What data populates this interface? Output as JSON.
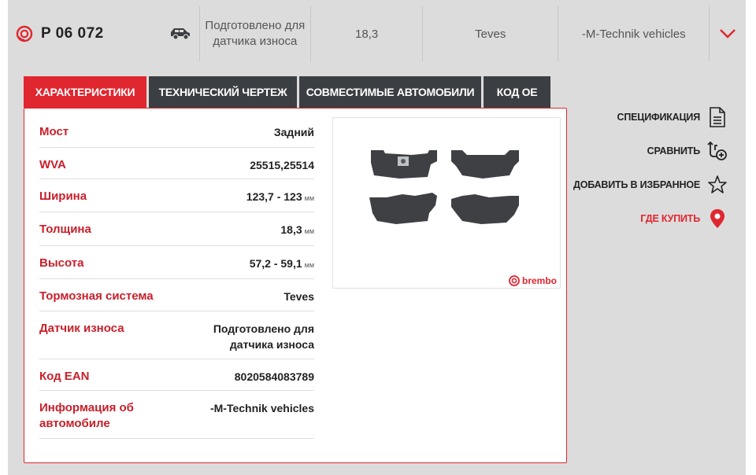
{
  "summary": {
    "part_number": "P 06 072",
    "wear_sensor": "Подготовлено для датчика износа",
    "thickness": "18,3",
    "brake_system": "Teves",
    "vehicle_info": "-M-Technik vehicles"
  },
  "tabs": [
    {
      "label": "ХАРАКТЕРИСТИКИ",
      "active": true
    },
    {
      "label": "ТЕХНИЧЕСКИЙ ЧЕРТЕЖ",
      "active": false
    },
    {
      "label": "СОВМЕСТИМЫЕ АВТОМОБИЛИ",
      "active": false
    },
    {
      "label": "КОД ОЕ",
      "active": false
    }
  ],
  "specs": [
    {
      "label": "Мост",
      "value": "Задний",
      "unit": ""
    },
    {
      "label": "WVA",
      "value": "25515,25514",
      "unit": ""
    },
    {
      "label": "Ширина",
      "value": "123,7 - 123",
      "unit": "мм"
    },
    {
      "label": "Толщина",
      "value": "18,3",
      "unit": "мм"
    },
    {
      "label": "Высота",
      "value": "57,2 - 59,1",
      "unit": "мм"
    },
    {
      "label": "Тормозная система",
      "value": "Teves",
      "unit": ""
    },
    {
      "label": "Датчик износа",
      "value": "Подготовлено для датчика износа",
      "unit": ""
    },
    {
      "label": "Код EAN",
      "value": "8020584083789",
      "unit": ""
    },
    {
      "label": "Информация об автомобиле",
      "value": "-M-Technik vehicles",
      "unit": ""
    }
  ],
  "image": {
    "brand_logo": "brembo"
  },
  "actions": {
    "spec": "СПЕЦИФИКАЦИЯ",
    "compare": "СРАВНИТЬ",
    "favorite": "ДОБАВИТЬ В ИЗБРАННОЕ",
    "buy": "ГДЕ КУПИТЬ"
  },
  "colors": {
    "accent": "#e0262f",
    "tab_dark": "#3b3e42",
    "panel_bg": "#dcdcdc"
  }
}
